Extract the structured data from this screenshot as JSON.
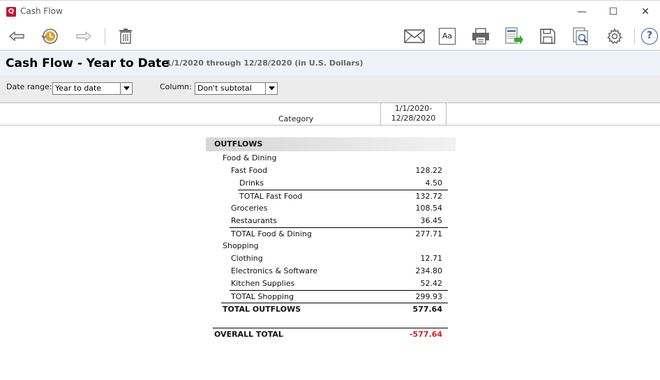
{
  "window": {
    "app_logo": "Q",
    "title": "Cash Flow",
    "controls": {
      "minimize": "—",
      "maximize": "☐",
      "close": "✕"
    }
  },
  "toolbar": {
    "icons": [
      "back-arrow-icon",
      "history-icon",
      "forward-arrow-icon",
      "trash-icon",
      "email-icon",
      "font-icon",
      "print-icon",
      "export-excel-icon",
      "save-icon",
      "preview-icon",
      "gear-icon",
      "help-icon"
    ],
    "font_label": "Aa",
    "help_label": "?"
  },
  "report": {
    "title": "Cash Flow - Year to Date",
    "subtitle": "1/1/2020 through 12/28/2020 (in U.S. Dollars)"
  },
  "controls": {
    "date_range_label": "Date range:",
    "date_range_value": "Year to date",
    "column_label": "Column:",
    "column_value": "Don't subtotal"
  },
  "columns": {
    "category": "Category",
    "date_line1": "1/1/2020-",
    "date_line2": "12/28/2020"
  },
  "outflows": {
    "header": "OUTFLOWS",
    "food_dining": "Food & Dining",
    "fast_food": "Fast Food",
    "drinks": {
      "label": "Drinks",
      "value": "4.50"
    },
    "total_fast_food": {
      "label": "TOTAL Fast Food",
      "value": "132.72"
    },
    "fast_food_value": "128.22",
    "groceries": {
      "label": "Groceries",
      "value": "108.54"
    },
    "restaurants": {
      "label": "Restaurants",
      "value": "36.45"
    },
    "total_food_dining": {
      "label": "TOTAL Food & Dining",
      "value": "277.71"
    },
    "shopping": "Shopping",
    "clothing": {
      "label": "Clothing",
      "value": "12.71"
    },
    "electronics": {
      "label": "Electronics & Software",
      "value": "234.80"
    },
    "kitchen": {
      "label": "Kitchen Supplies",
      "value": "52.42"
    },
    "total_shopping": {
      "label": "TOTAL Shopping",
      "value": "299.93"
    },
    "total_outflows": {
      "label": "TOTAL OUTFLOWS",
      "value": "577.64"
    }
  },
  "overall_total": {
    "label": "OVERALL TOTAL",
    "value": "-577.64"
  },
  "colors": {
    "negative": "#d21f1f",
    "logo": "#c8102e",
    "history_icon": "#e0a22a"
  }
}
